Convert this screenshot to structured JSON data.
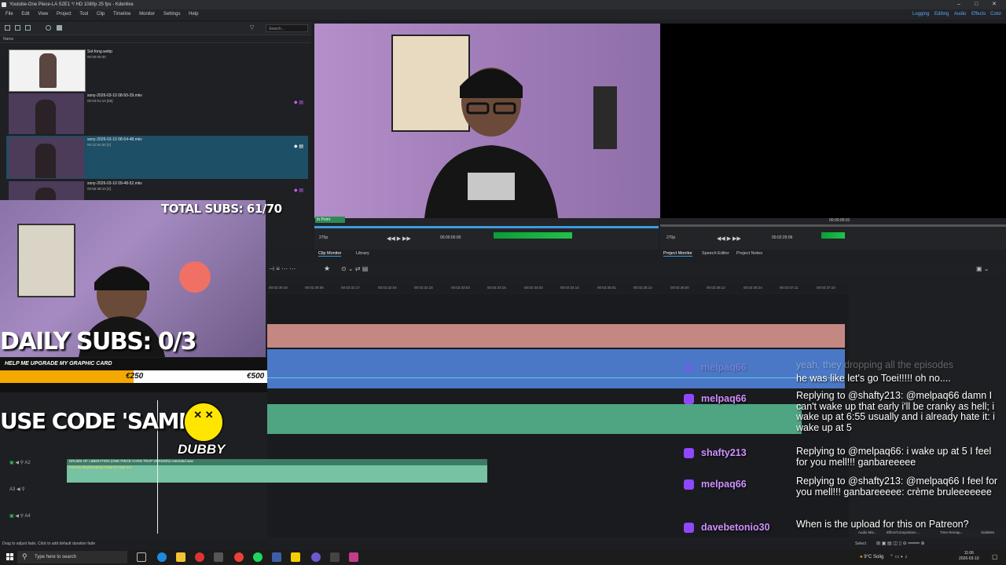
{
  "window": {
    "title": "Youtube-One Piece-LA S2E1 */ HD 1080p 25 fps - Kdenlive",
    "controls": [
      "–",
      "□",
      "✕"
    ]
  },
  "menu": {
    "items": [
      "File",
      "Edit",
      "View",
      "Project",
      "Tool",
      "Clip",
      "Timeline",
      "Monitor",
      "Settings",
      "Help"
    ],
    "workspaces": [
      "Logging",
      "Editing",
      "Audio",
      "Effects",
      "Color"
    ]
  },
  "bin": {
    "search_placeholder": "Search...",
    "column_header": "Name",
    "clips": [
      {
        "name": "Sol-fong.webp",
        "duration": "00:00:05:00"
      },
      {
        "name": "sony-2026-03-10 08-50-29.mkv",
        "duration": "00:03:51:14 [56]"
      },
      {
        "name": "sony-2026-03-10 08-54-48.mkv",
        "duration": "00:12:04:00 [2]"
      },
      {
        "name": "sony-2026-03-10 09-48-52.mkv",
        "duration": "00:55:38:10 [2]"
      }
    ]
  },
  "overlay": {
    "total_subs": "TOTAL SUBS: 61/70",
    "daily_subs": "DAILY SUBS: 0/3",
    "goal_title": "HELP ME UPGRADE MY GRAPHIC CARD",
    "goal_current": "€250",
    "goal_target": "€500",
    "goal_progress": 0.5,
    "code_line": "USE CODE 'SAMISY'",
    "dubby": "DUBBY",
    "accent": "#f5a800"
  },
  "clip_monitor": {
    "in_point": "In Point",
    "zoom": "270p",
    "timecode": "00:00:00:00",
    "tabs": [
      "Clip Monitor",
      "Library"
    ]
  },
  "project_monitor": {
    "zoom": "270p",
    "timecode": "00:02:29:06",
    "ruler_time": "00:00:00:01",
    "tabs": [
      "Project Monitor",
      "Speech Editor",
      "Project Notes"
    ]
  },
  "timeline": {
    "ruler_ticks": [
      "00:02:30:18",
      "00:02:35:05",
      "00:02:31:17",
      "00:02:32:04",
      "00:02:32:16",
      "00:02:33:03",
      "00:02:33:15",
      "00:02:34:02",
      "00:02:34:14",
      "00:02:35:01",
      "00:02:35:13",
      "00:02:36:00",
      "00:02:36:12",
      "00:02:36:24",
      "00:02:37:11",
      "00:02:37:23"
    ],
    "audio_clip_label": "DRUMS OF LIBERATION (ONE PIECE HARD TRAP VERSION) extended.wav",
    "audio_effect": "Volume (keyframable) Fade in Fade out",
    "track_labels": [
      "A1",
      "A2",
      "A3",
      "A4"
    ],
    "playhead_color": "#eeeeee"
  },
  "chat": {
    "messages": [
      {
        "user": "melpaq66",
        "text": "Replying to @shafty213: @melpaq66 damn I can't wake up that early i'll be cranky as hell; i wake up at 6:55 usually and i already hate it: i wake up at 5"
      },
      {
        "user": "shafty213",
        "text": "Replying to @melpaq66: i wake up at 5    I feel for you mell!!! ganbareeeee"
      },
      {
        "user": "melpaq66",
        "text": "Replying to @shafty213: @melpaq66 I feel for you mell!!! ganbareeeee:  crème bruleeeeeee"
      },
      {
        "user": "davebetonio30",
        "text": "When is the upload for this on Patreon?"
      }
    ],
    "faded_line_1": "yeah, they dropping all the episodes",
    "faded_line_2": "he was like let's go Toei!!!!! oh no....",
    "faded_user": "melpaq66",
    "twitch_color": "#9146ff"
  },
  "status_bar": {
    "hint": "Drag to adjust fade, Click to add default duration fade",
    "select_label": "Select"
  },
  "taskbar": {
    "search_placeholder": "Type here to search",
    "weather": "9°C Solig",
    "time": "11:06",
    "date": "2026-03-10"
  },
  "bottom_tabs": [
    "Audio Mix...",
    "Effect/Composition ...",
    "Time Remap...",
    "Subtitles"
  ]
}
